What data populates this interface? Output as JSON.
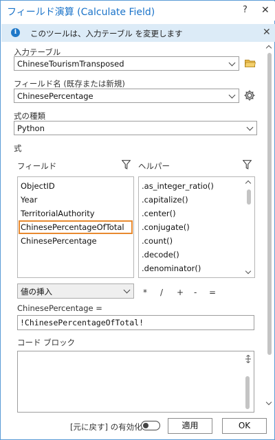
{
  "window": {
    "title": "フィールド演算 (Calculate Field)",
    "help_label": "?",
    "close_label": "✕"
  },
  "banner": {
    "text": "このツールは、入力テーブル を変更します",
    "close_label": "✕"
  },
  "input_table": {
    "label": "入力テーブル",
    "value": "ChineseTourismTransposed"
  },
  "field_name": {
    "label": "フィールド名 (既存または新規)",
    "value": "ChinesePercentage"
  },
  "expression_type": {
    "label": "式の種類",
    "value": "Python"
  },
  "expression": {
    "section_label": "式",
    "fields_label": "フィールド",
    "helpers_label": "ヘルパー",
    "fields": [
      "ObjectID",
      "Year",
      "TerritorialAuthority",
      "ChinesePercentageOfTotal",
      "ChinesePercentage"
    ],
    "selected_field": "ChinesePercentageOfTotal",
    "helpers": [
      ".as_integer_ratio()",
      ".capitalize()",
      ".center()",
      ".conjugate()",
      ".count()",
      ".decode()",
      ".denominator()"
    ],
    "insert_values_label": "値の挿入",
    "operators": [
      "*",
      "/",
      "+",
      "-",
      "="
    ],
    "target_label": "ChinesePercentage =",
    "expression_value": "!ChinesePercentageOfTotal!"
  },
  "code_block": {
    "label": "コード ブロック",
    "value": ""
  },
  "footer": {
    "undo_label": "[元に戻す] の有効化",
    "undo_enabled": false,
    "apply_label": "適用",
    "ok_label": "OK"
  },
  "colors": {
    "title": "#1a73c9",
    "banner_bg": "#dcebf7",
    "selection_border": "#e8892e"
  }
}
